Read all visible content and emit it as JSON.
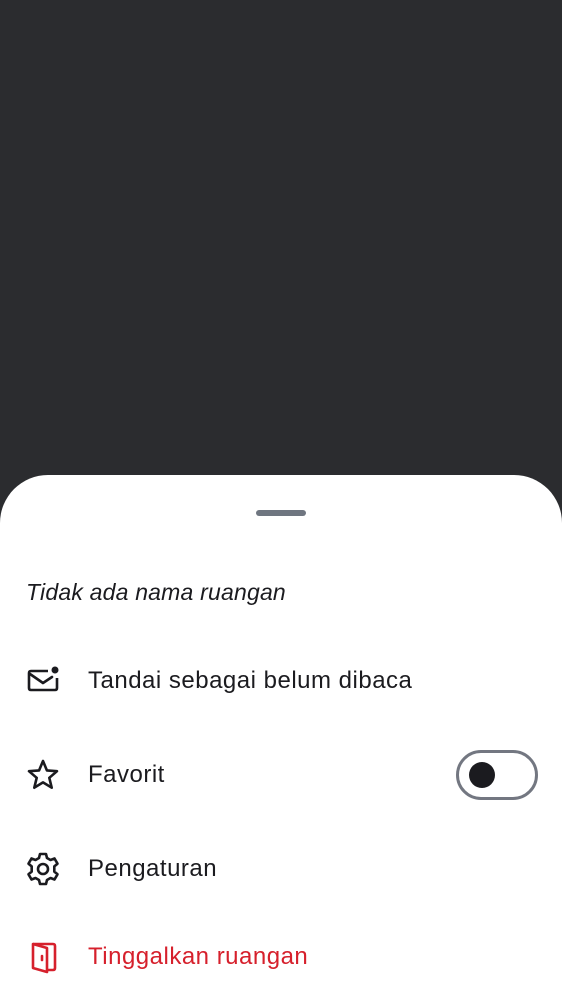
{
  "sheet": {
    "title": "Tidak ada nama ruangan",
    "items": [
      {
        "icon": "mark-unread-icon",
        "label": "Tandai sebagai belum dibaca"
      },
      {
        "icon": "star-outline-icon",
        "label": "Favorit",
        "toggle_on": false
      },
      {
        "icon": "settings-gear-icon",
        "label": "Pengaturan"
      },
      {
        "icon": "leave-door-icon",
        "label": "Tinggalkan ruangan"
      }
    ]
  },
  "colors": {
    "scrim": "#2b2c2f",
    "sheet_background": "#ffffff",
    "text": "#1b1b1f",
    "danger": "#d6202c",
    "handle": "#6f7680"
  }
}
